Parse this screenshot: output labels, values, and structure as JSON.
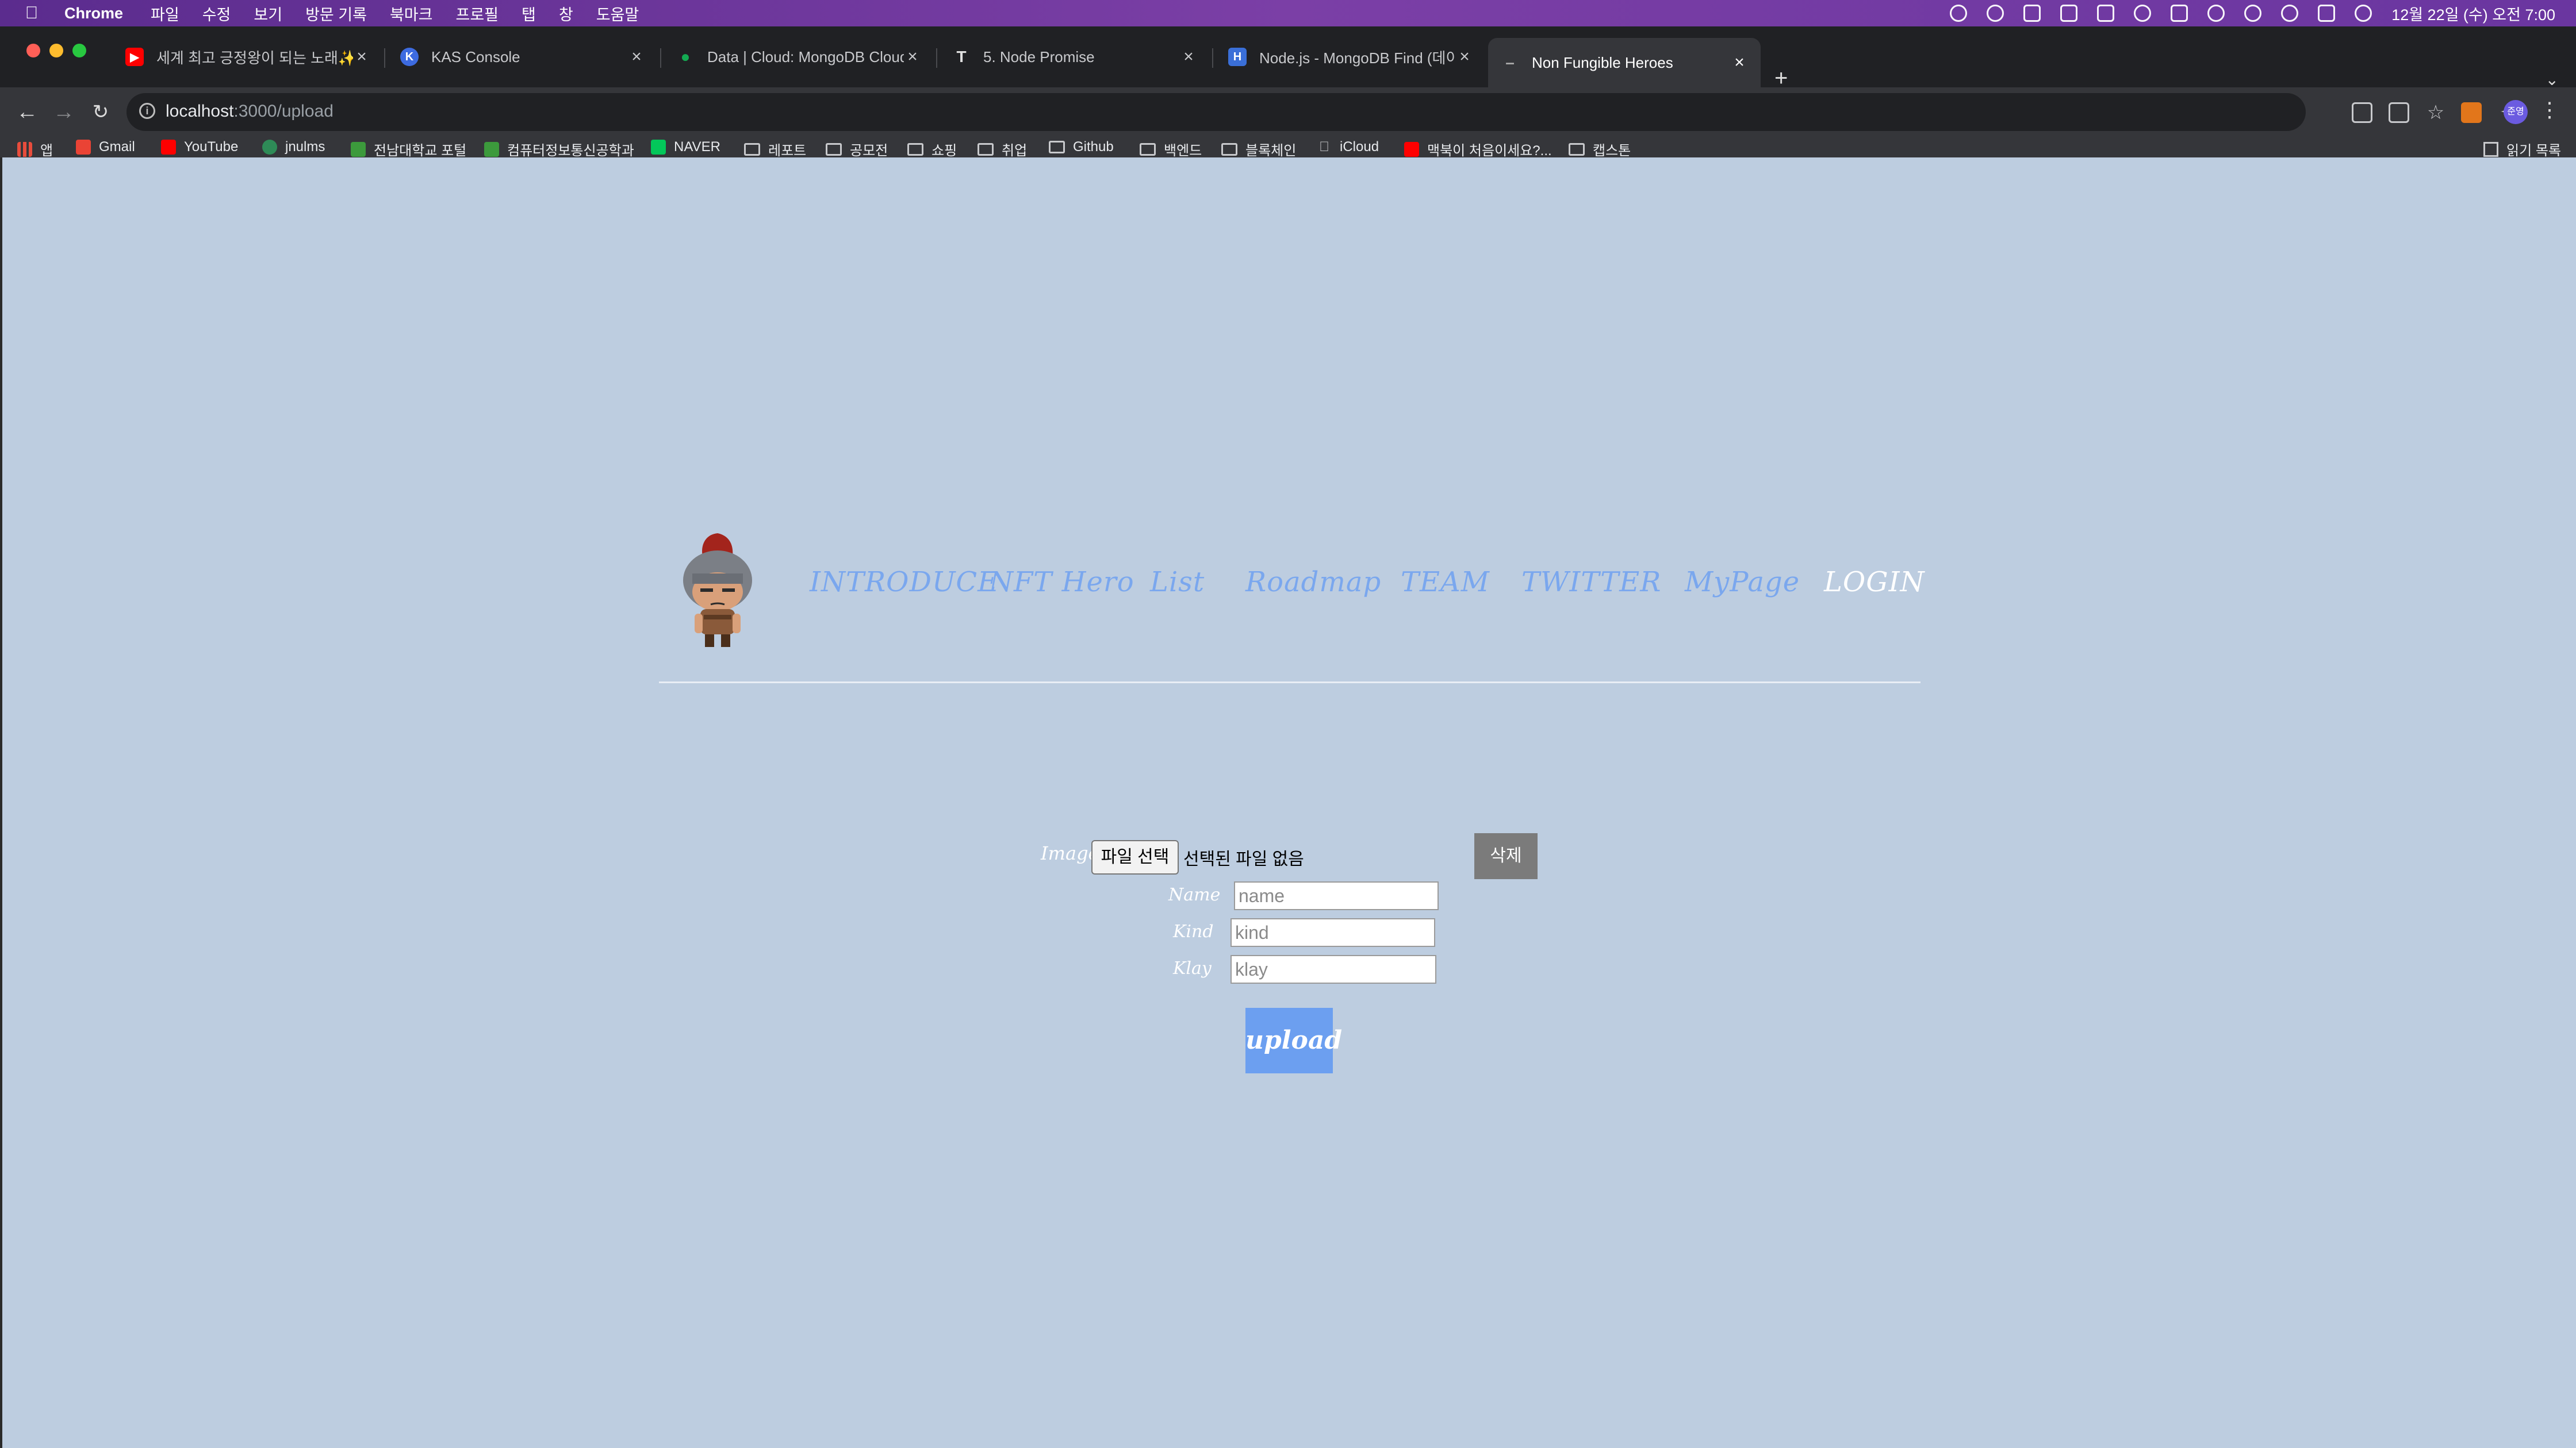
{
  "menubar": {
    "items": [
      "Chrome",
      "파일",
      "수정",
      "보기",
      "방문 기록",
      "북마크",
      "프로필",
      "탭",
      "창",
      "도움말"
    ],
    "clock": "12월 22일 (수) 오전 7:00"
  },
  "tabs": [
    {
      "title": "세계 최고 긍정왕이 되는 노래✨🎵",
      "icon": "youtube-icon",
      "color": "#ff0000"
    },
    {
      "title": "KAS Console",
      "icon": "kas-icon",
      "color": "#3d6be0"
    },
    {
      "title": "Data | Cloud: MongoDB Cloud",
      "icon": "mongodb-leaf-icon",
      "color": "#13aa52"
    },
    {
      "title": "5. Node Promise",
      "icon": "tistory-icon",
      "color": "#333333"
    },
    {
      "title": "Node.js - MongoDB Find (데이터",
      "icon": "h-icon",
      "color": "#3a6fd8"
    },
    {
      "title": "Non Fungible Heroes",
      "icon": "dash-icon",
      "color": "#888888"
    }
  ],
  "address": {
    "host": "localhost",
    "path": ":3000/upload"
  },
  "bookmarks": {
    "items": [
      "앱",
      "Gmail",
      "YouTube",
      "jnulms",
      "전남대학교 포털",
      "컴퓨터정보통신공학과",
      "NAVER",
      "레포트",
      "공모전",
      "쇼핑",
      "취업",
      "Github",
      "백엔드",
      "블록체인",
      "iCloud",
      "맥북이 처음이세요?...",
      "캡스톤"
    ],
    "reading_list": "읽기 목록"
  },
  "profile_initials": "준영",
  "site": {
    "nav": [
      "INTRODUCE",
      "NFT Hero",
      "List",
      "Roadmap",
      "TEAM",
      "TWITTER",
      "MyPage",
      "LOGIN"
    ]
  },
  "form": {
    "image_label": "Image",
    "file_button": "파일 선택",
    "file_status": "선택된 파일 없음",
    "delete_button": "삭제",
    "name_label": "Name",
    "name_placeholder": "name",
    "kind_label": "Kind",
    "kind_placeholder": "kind",
    "klay_label": "Klay",
    "klay_placeholder": "klay",
    "upload_button": "upload"
  },
  "colors": {
    "page_bg": "#bdcde0",
    "nav_link": "#7aa7ee",
    "upload_button": "#6c9ff0",
    "delete_button": "#7b7b7b"
  }
}
